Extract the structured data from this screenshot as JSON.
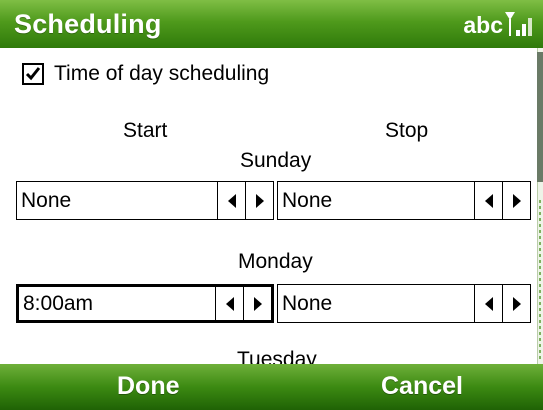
{
  "title_bar": {
    "title": "Scheduling",
    "input_mode": "abc",
    "signal_icon": "signal-strength-icon"
  },
  "options": {
    "time_of_day_label": "Time of day scheduling",
    "time_of_day_checked": true
  },
  "columns": {
    "start": "Start",
    "stop": "Stop"
  },
  "days": [
    {
      "label": "Sunday",
      "start": "None",
      "stop": "None"
    },
    {
      "label": "Monday",
      "start": "8:00am",
      "stop": "None"
    },
    {
      "label": "Tuesday"
    }
  ],
  "softkeys": {
    "left": "Done",
    "right": "Cancel"
  },
  "colors": {
    "bar_green": "#4f9a1c",
    "bar_green_dark": "#2f7a0a",
    "text": "#000000"
  }
}
